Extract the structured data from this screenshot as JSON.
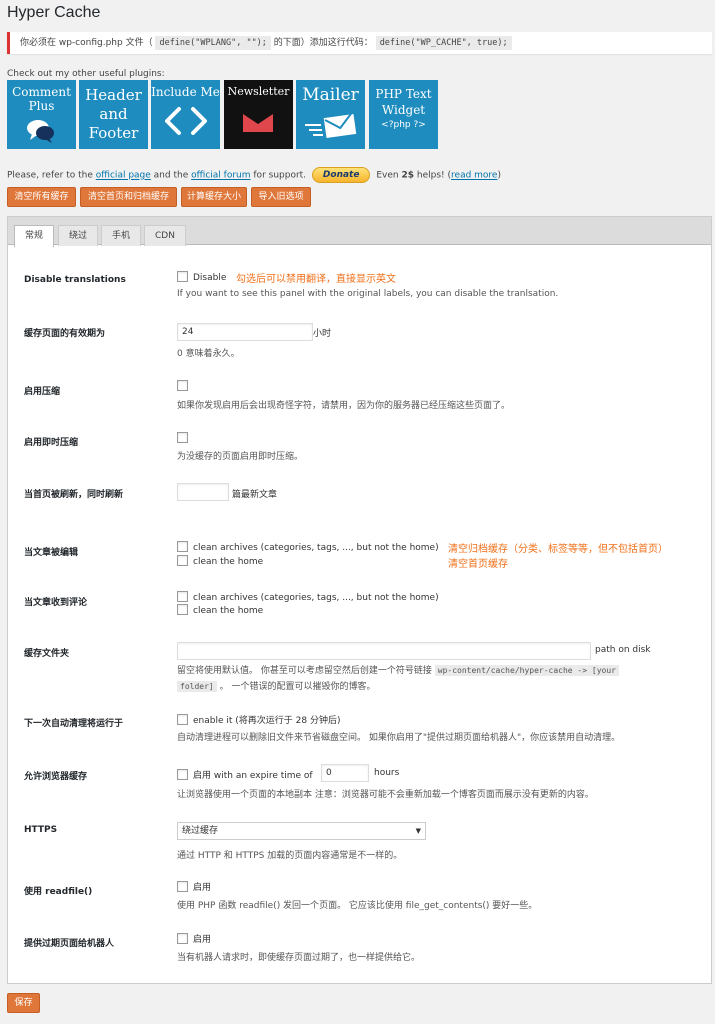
{
  "app": {
    "title": "Hyper Cache"
  },
  "notice": {
    "text_before": "你必须在 wp-config.php 文件（",
    "code1": "define(\"WPLANG\", \"\");",
    "text_middle": "的下面）添加这行代码：",
    "code2": "define(\"WP_CACHE\", true);"
  },
  "plugins": {
    "label": "Check out my other useful plugins:",
    "tiles": [
      {
        "name": "Comment Plus",
        "icon": "speech-bubbles-icon"
      },
      {
        "name": "Header and Footer",
        "icon": ""
      },
      {
        "name": "Include Me",
        "icon": "code-brackets-icon"
      },
      {
        "name": "Newsletter",
        "icon": "envelope-icon"
      },
      {
        "name": "Mailer",
        "icon": "flying-envelope-icon"
      },
      {
        "name": "PHP Text Widget",
        "icon": "php-tag-icon",
        "sub": "<?php ?>"
      }
    ],
    "tile_colors": {
      "blue": "#1e8cbe",
      "newsletter": "#111111",
      "newsletter_icon": "#e0474c"
    }
  },
  "support": {
    "before": "Please, refer to the",
    "official_page": "official page",
    "and_the": "and the",
    "official_forum": "official forum",
    "for_support": "for support.",
    "donate": "Donate",
    "even": "Even",
    "amount": "2$",
    "helps": "helps!",
    "read_more": "read more"
  },
  "actions": [
    "清空所有缓存",
    "清空首页和归档缓存",
    "计算缓存大小",
    "导入旧选项"
  ],
  "tabs": [
    "常规",
    "绕过",
    "手机",
    "CDN"
  ],
  "settings": {
    "disable_translations": {
      "label": "Disable translations",
      "option": "Disable",
      "note": "勾选后可以禁用翻译，直接显示英文",
      "desc": "If you want to see this panel with the original labels, you can disable the tranlsation."
    },
    "cache_lifetime": {
      "label": "缓存页面的有效期为",
      "value": "24",
      "unit": "小时",
      "desc": "0 意味着永久。"
    },
    "compression": {
      "label": "启用压缩",
      "desc": "如果你发现启用后会出现奇怪字符，请禁用，因为你的服务器已经压缩这些页面了。"
    },
    "on_the_fly": {
      "label": "启用即时压缩",
      "desc": "为没缓存的页面启用即时压缩。"
    },
    "home_refresh": {
      "label": "当首页被刷新，同时刷新",
      "value": "",
      "unit": "篇最新文章"
    },
    "post_edited": {
      "label": "当文章被编辑",
      "opt1": "clean archives (categories, tags, ..., but not the home)",
      "opt2": "clean the home",
      "note1": "清空归档缓存（分类、标签等等，但不包括首页）",
      "note2": "清空首页缓存"
    },
    "post_commented": {
      "label": "当文章收到评论",
      "opt1": "clean archives (categories, tags, ..., but not the home)",
      "opt2": "clean the home"
    },
    "cache_folder": {
      "label": "缓存文件夹",
      "value": "",
      "unit": "path on disk",
      "desc_before": "留空将使用默认值。 你甚至可以考虑留空然后创建一个符号链接",
      "code1": "wp-content/cache/hyper-cache -> [your",
      "code2": "folder]",
      "desc_after": "。 一个错误的配置可以摧毁你的博客。"
    },
    "autoclean": {
      "label": "下一次自动清理将运行于",
      "option": "enable it (将再次运行于 28 分钟后)",
      "desc": "自动清理进程可以删除旧文件来节省磁盘空间。 如果你启用了\"提供过期页面给机器人\"，你应该禁用自动清理。"
    },
    "browser_cache": {
      "label": "允许浏览器缓存",
      "option": "启用 with an expire time of",
      "value": "0",
      "unit": "hours",
      "desc": "让浏览器使用一个页面的本地副本 注意：浏览器可能不会重新加载一个博客页面而展示没有更新的内容。"
    },
    "https": {
      "label": "HTTPS",
      "value": "绕过缓存",
      "desc": "通过 HTTP 和 HTTPS 加载的页面内容通常是不一样的。"
    },
    "readfile": {
      "label": "使用 readfile()",
      "option": "启用",
      "desc": "使用 PHP 函数 readfile() 发回一个页面。 它应该比使用 file_get_contents() 要好一些。"
    },
    "bots": {
      "label": "提供过期页面给机器人",
      "option": "启用",
      "desc": "当有机器人请求时，即使缓存页面过期了，也一样提供给它。"
    }
  },
  "save": "保存",
  "colors": {
    "accent": "#e0773a",
    "link": "#0073aa",
    "annotation": "#f0701a",
    "notice_border": "#dc3232"
  }
}
